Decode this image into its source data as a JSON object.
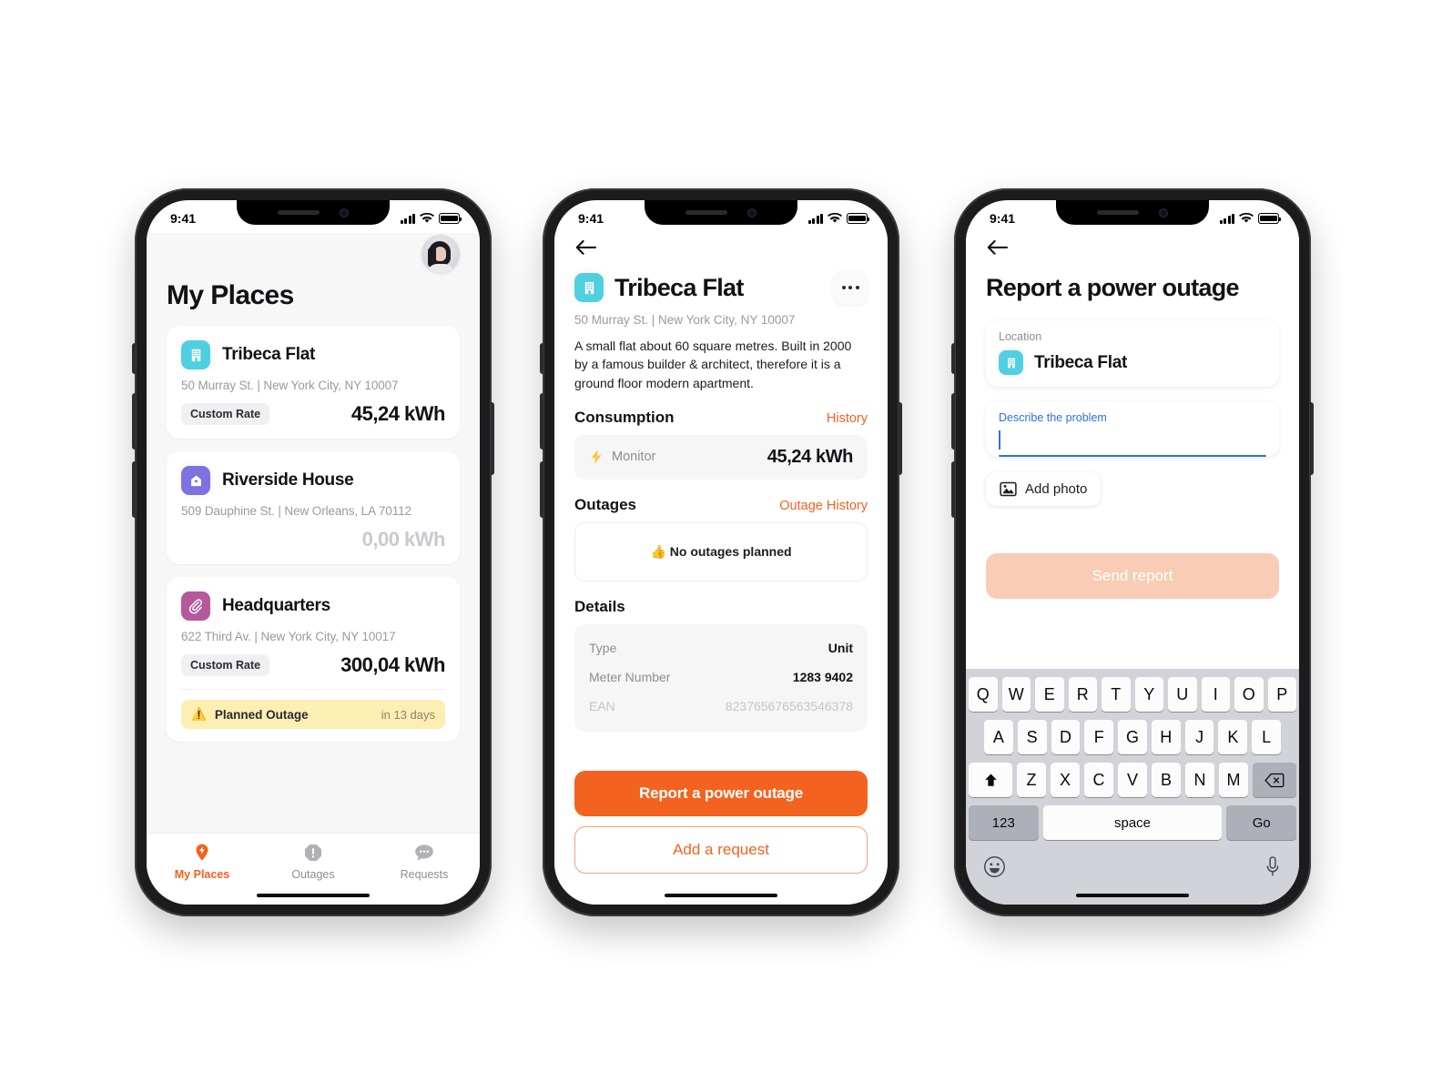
{
  "status_bar": {
    "time": "9:41",
    "cellular_icon": "signal-bars-icon",
    "wifi_icon": "wifi-icon",
    "battery_icon": "battery-icon"
  },
  "screen1": {
    "avatar_name": "user-avatar",
    "title": "My Places",
    "places": [
      {
        "icon": "building-icon",
        "icon_color": "#4fd0e0",
        "name": "Tribeca Flat",
        "address": "50 Murray St. | New York City, NY 10007",
        "rate_chip": "Custom Rate",
        "consumption": "45,24 kWh",
        "muted": false,
        "outage": null
      },
      {
        "icon": "house-icon",
        "icon_color": "#7c72e0",
        "name": "Riverside House",
        "address": "509 Dauphine St. | New Orleans, LA 70112",
        "rate_chip": null,
        "consumption": "0,00 kWh",
        "muted": true,
        "outage": null
      },
      {
        "icon": "paperclip-icon",
        "icon_color": "#b4599b",
        "name": "Headquarters",
        "address": "622 Third Av. | New York City, NY 10017",
        "rate_chip": "Custom Rate",
        "consumption": "300,04 kWh",
        "muted": false,
        "outage": {
          "emoji": "⚠️",
          "label": "Planned Outage",
          "when": "in 13 days"
        }
      }
    ],
    "tabs": [
      {
        "label": "My Places",
        "icon": "location-pin-bolt-icon",
        "active": true
      },
      {
        "label": "Outages",
        "icon": "alert-octagon-icon",
        "active": false
      },
      {
        "label": "Requests",
        "icon": "chat-bubble-icon",
        "active": false
      }
    ]
  },
  "screen2": {
    "back_icon": "back-arrow-icon",
    "icon": "building-icon",
    "title": "Tribeca Flat",
    "more_icon": "more-options-icon",
    "address": "50 Murray St. | New York City, NY 10007",
    "description": "A small flat about 60 square metres. Built in 2000 by a famous builder & architect, therefore it is a ground floor modern apartment.",
    "consumption": {
      "heading": "Consumption",
      "link": "History",
      "row_icon": "lightning-bolt-icon",
      "row_label": "Monitor",
      "row_value": "45,24 kWh"
    },
    "outages": {
      "heading": "Outages",
      "link": "Outage History",
      "empty_emoji": "👍",
      "empty_text": "No outages planned"
    },
    "details": {
      "heading": "Details",
      "rows": [
        {
          "key": "Type",
          "value": "Unit",
          "faded": false
        },
        {
          "key": "Meter Number",
          "value": "1283 9402",
          "faded": false
        },
        {
          "key": "EAN",
          "value": "823765676563546378",
          "faded": true
        }
      ]
    },
    "primary_button": "Report a power outage",
    "secondary_button": "Add a request"
  },
  "screen3": {
    "back_icon": "back-arrow-icon",
    "title": "Report a power outage",
    "location_field": {
      "label": "Location",
      "icon": "building-icon",
      "value": "Tribeca Flat"
    },
    "describe_field": {
      "label": "Describe the problem",
      "value": ""
    },
    "add_photo": {
      "icon": "photo-icon",
      "label": "Add photo"
    },
    "send_button": "Send report",
    "keyboard": {
      "row1": [
        "Q",
        "W",
        "E",
        "R",
        "T",
        "Y",
        "U",
        "I",
        "O",
        "P"
      ],
      "row2": [
        "A",
        "S",
        "D",
        "F",
        "G",
        "H",
        "J",
        "K",
        "L"
      ],
      "row3": [
        "Z",
        "X",
        "C",
        "V",
        "B",
        "N",
        "M"
      ],
      "shift_icon": "shift-icon",
      "backspace_icon": "backspace-icon",
      "numbers_key": "123",
      "space_key": "space",
      "return_key": "Go",
      "emoji_icon": "emoji-icon",
      "mic_icon": "microphone-icon"
    }
  },
  "colors": {
    "accent": "#f4621f",
    "focus_blue": "#2f6fe4",
    "warning_yellow": "#fdeeb4"
  }
}
